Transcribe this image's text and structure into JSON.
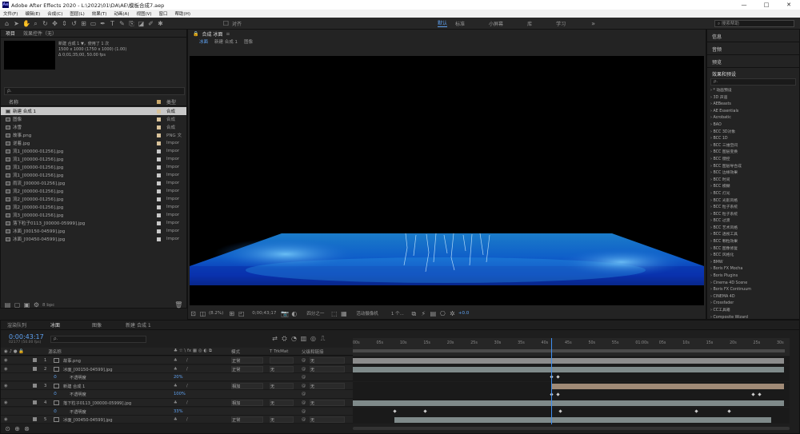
{
  "window": {
    "title": "Adobe After Effects 2020 - L:\\2022\\01\\DA\\AE\\模板合成7.aep",
    "controls": [
      "—",
      "□",
      "✕"
    ]
  },
  "menu": [
    "文件(F)",
    "编辑(E)",
    "合成(C)",
    "图层(L)",
    "效果(T)",
    "动画(A)",
    "视图(V)",
    "窗口",
    "帮助(H)"
  ],
  "toolbar": {
    "snap_label": "对齐",
    "workspaces": [
      "默认",
      "标准",
      "小屏幕",
      "库",
      "学习"
    ],
    "search_help": "搜索帮助"
  },
  "project": {
    "tabs": [
      "项目",
      "效果控件（无）"
    ],
    "selected_name": "新建 合成 1 ▼，使用了 1 次",
    "selected_info1": "1500 x 1000 (1750 x 1000) (1.00)",
    "selected_info2": "Δ 0;01;35;00, 50.00 fps",
    "search_placeholder": "ρ.",
    "col_name": "名称",
    "col_type": "类型",
    "items": [
      {
        "name": "新建 合成 1",
        "type": "合成",
        "color": "#d9c39a"
      },
      {
        "name": "图像",
        "type": "合成",
        "color": "#d9c39a"
      },
      {
        "name": "冰雪",
        "type": "合成",
        "color": "#d9c39a"
      },
      {
        "name": "故事.png",
        "type": "PNG 文",
        "color": "#d9c39a"
      },
      {
        "name": "逆着.jpg",
        "type": "Impor",
        "color": "#d9c39a"
      },
      {
        "name": "流1_[00000-01256].jpg",
        "type": "Impor",
        "color": "#c8c8c8"
      },
      {
        "name": "流1_[00000-01256].jpg",
        "type": "Impor",
        "color": "#c8c8c8"
      },
      {
        "name": "流1_[00000-01256].jpg",
        "type": "Impor",
        "color": "#c8c8c8"
      },
      {
        "name": "流1_[00000-01256].jpg",
        "type": "Impor",
        "color": "#c8c8c8"
      },
      {
        "name": "雨流_[00000-01256].jpg",
        "type": "Impor",
        "color": "#c8c8c8"
      },
      {
        "name": "流2_[00000-01256].jpg",
        "type": "Impor",
        "color": "#c8c8c8"
      },
      {
        "name": "流2_[00000-01256].jpg",
        "type": "Impor",
        "color": "#c8c8c8"
      },
      {
        "name": "流2_[00000-01256].jpg",
        "type": "Impor",
        "color": "#c8c8c8"
      },
      {
        "name": "流3_[00000-01256].jpg",
        "type": "Impor",
        "color": "#c8c8c8"
      },
      {
        "name": "落下粒子0113_[00000-05999].jpg",
        "type": "Impor",
        "color": "#c8c8c8"
      },
      {
        "name": "冰面_[00150-04599].jpg",
        "type": "Impor",
        "color": "#c8c8c8"
      },
      {
        "name": "冰面_[00450-04599].jpg",
        "type": "Impor",
        "color": "#c8c8c8"
      }
    ],
    "bpc": "8 bpc"
  },
  "composition": {
    "tab": "合成 冰面",
    "breadcrumbs": [
      "冰面",
      "新建 合成 1",
      "图像"
    ],
    "zoom": "(8.2%)",
    "timecode": "0;00;43;17",
    "resolution": "四分之一",
    "camera": "活动摄像机",
    "views": "1 个...",
    "exposure": "+0.0"
  },
  "right_panel": {
    "info": "信息",
    "audio": "音频",
    "preview": "预览",
    "effects_title": "效果和预设",
    "search_placeholder": "ρ.",
    "effects": [
      "* 动画预设",
      "3D 声道",
      "AEBeasts",
      "AE Essentials",
      "Acrobatic",
      "BAO",
      "BCC 3D对象",
      "BCC 1D",
      "BCC 三维空间",
      "BCC 图层变换",
      "BCC 键控",
      "BCC 图层导合成",
      "BCC 边缘效果",
      "BCC 时间",
      "BCC 模糊",
      "BCC 灯光",
      "BCC 光影风格",
      "BCC 粒子系统",
      "BCC 粒子系统",
      "BCC 过渡",
      "BCC 艺术风格",
      "BCC 透视工具",
      "BCC 颗粒效果",
      "BCC 图像修复",
      "BCC 风格化",
      "BMW",
      "Boris FX Mocha",
      "Boris Plugins",
      "Cinema 4D Scene",
      "Boris FX Continuum",
      "CINEMA 4D",
      "Crossfader",
      "CC工具箱",
      "Composite Wizard"
    ]
  },
  "timeline": {
    "tabs": [
      "渲染队列",
      "冰面",
      "图像",
      "新建 合成 1"
    ],
    "timecode": "0:00:43:17",
    "timecode_sub": "02177 (50.00 fps)",
    "search_placeholder": "ρ.",
    "col_name": "源名称",
    "col_mode": "模式",
    "col_trkmat": "T TrkMat",
    "col_parent": "父级和链接",
    "ruler": [
      "00s",
      "05s",
      "10s",
      "15s",
      "20s",
      "25s",
      "30s",
      "35s",
      "40s",
      "45s",
      "50s",
      "55s",
      "01:00s",
      "05s",
      "10s",
      "15s",
      "20s",
      "25s",
      "30s"
    ],
    "layers": [
      {
        "num": "1",
        "name": "故事.png",
        "mode": "正常",
        "trk": "",
        "parent": "无",
        "sub": false,
        "bar": [
          0.0,
          0.987
        ],
        "bar_color": "#8c8c8c",
        "keys": []
      },
      {
        "num": "2",
        "name": "冰面_[00150-04599].jpg",
        "mode": "正常",
        "trk": "无",
        "parent": "无",
        "sub": false,
        "bar": [
          0.0,
          0.987
        ],
        "bar_color": "#7f8a8a",
        "keys": []
      },
      {
        "num": "",
        "name": "不透明度",
        "mode": "",
        "trk": "",
        "parent": "",
        "sub": true,
        "value": "20%",
        "keys": [
          0.455,
          0.468
        ]
      },
      {
        "num": "3",
        "name": "新建 合成 1",
        "mode": "相加",
        "trk": "无",
        "parent": "无",
        "sub": false,
        "bar": [
          0.455,
          0.987
        ],
        "bar_color": "#a08a76",
        "keys": []
      },
      {
        "num": "",
        "name": "不透明度",
        "mode": "",
        "trk": "",
        "parent": "",
        "sub": true,
        "value": "100%",
        "keys": [
          0.455,
          0.468,
          0.915,
          0.93
        ]
      },
      {
        "num": "4",
        "name": "落下粒子0113_[00000-05999].jpg",
        "mode": "相加",
        "trk": "无",
        "parent": "无",
        "sub": false,
        "bar": [
          0.0,
          0.987
        ],
        "bar_color": "#7f8a8a",
        "keys": []
      },
      {
        "num": "",
        "name": "不透明度",
        "mode": "",
        "trk": "",
        "parent": "",
        "sub": true,
        "value": "33%",
        "keys": [
          0.095,
          0.165,
          0.475,
          0.785,
          0.86
        ]
      },
      {
        "num": "5",
        "name": "冰面_[00450-04599].jpg",
        "mode": "正常",
        "trk": "无",
        "parent": "无",
        "sub": false,
        "bar": [
          0.095,
          0.957
        ],
        "bar_color": "#7f8a8a",
        "keys": []
      }
    ],
    "playhead": 0.455
  }
}
